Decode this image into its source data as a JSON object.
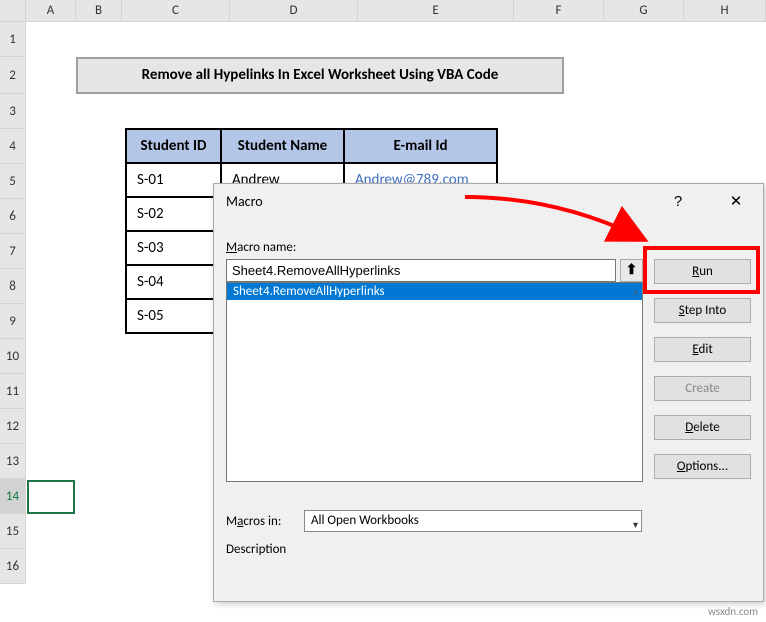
{
  "columns": [
    "A",
    "B",
    "C",
    "D",
    "E",
    "F",
    "G",
    "H"
  ],
  "row_count": 16,
  "title_cell": "Remove all Hypelinks In Excel Worksheet Using VBA Code",
  "headers": {
    "id": "Student ID",
    "name": "Student Name",
    "email": "E-mail Id"
  },
  "rows_data": [
    {
      "id": "S-01",
      "name": "Andrew",
      "email": "Andrew@789.com"
    },
    {
      "id": "S-02",
      "name": "",
      "email": ""
    },
    {
      "id": "S-03",
      "name": "",
      "email": ""
    },
    {
      "id": "S-04",
      "name": "",
      "email": ""
    },
    {
      "id": "S-05",
      "name": "",
      "email": ""
    }
  ],
  "dialog": {
    "title": "Macro",
    "help": "?",
    "close": "✕",
    "macro_name_label": "Macro name:",
    "macro_name_value": "Sheet4.RemoveAllHyperlinks",
    "list_item": "Sheet4.RemoveAllHyperlinks",
    "macros_in_label": "Macros in:",
    "macros_in_value": "All Open Workbooks",
    "description_label": "Description",
    "buttons": {
      "run": "Run",
      "step_into": "Step Into",
      "edit": "Edit",
      "create": "Create",
      "delete": "Delete",
      "options": "Options..."
    },
    "upload_icon": "⬆"
  },
  "selected_row": 14,
  "watermark": "wsxdn.com"
}
